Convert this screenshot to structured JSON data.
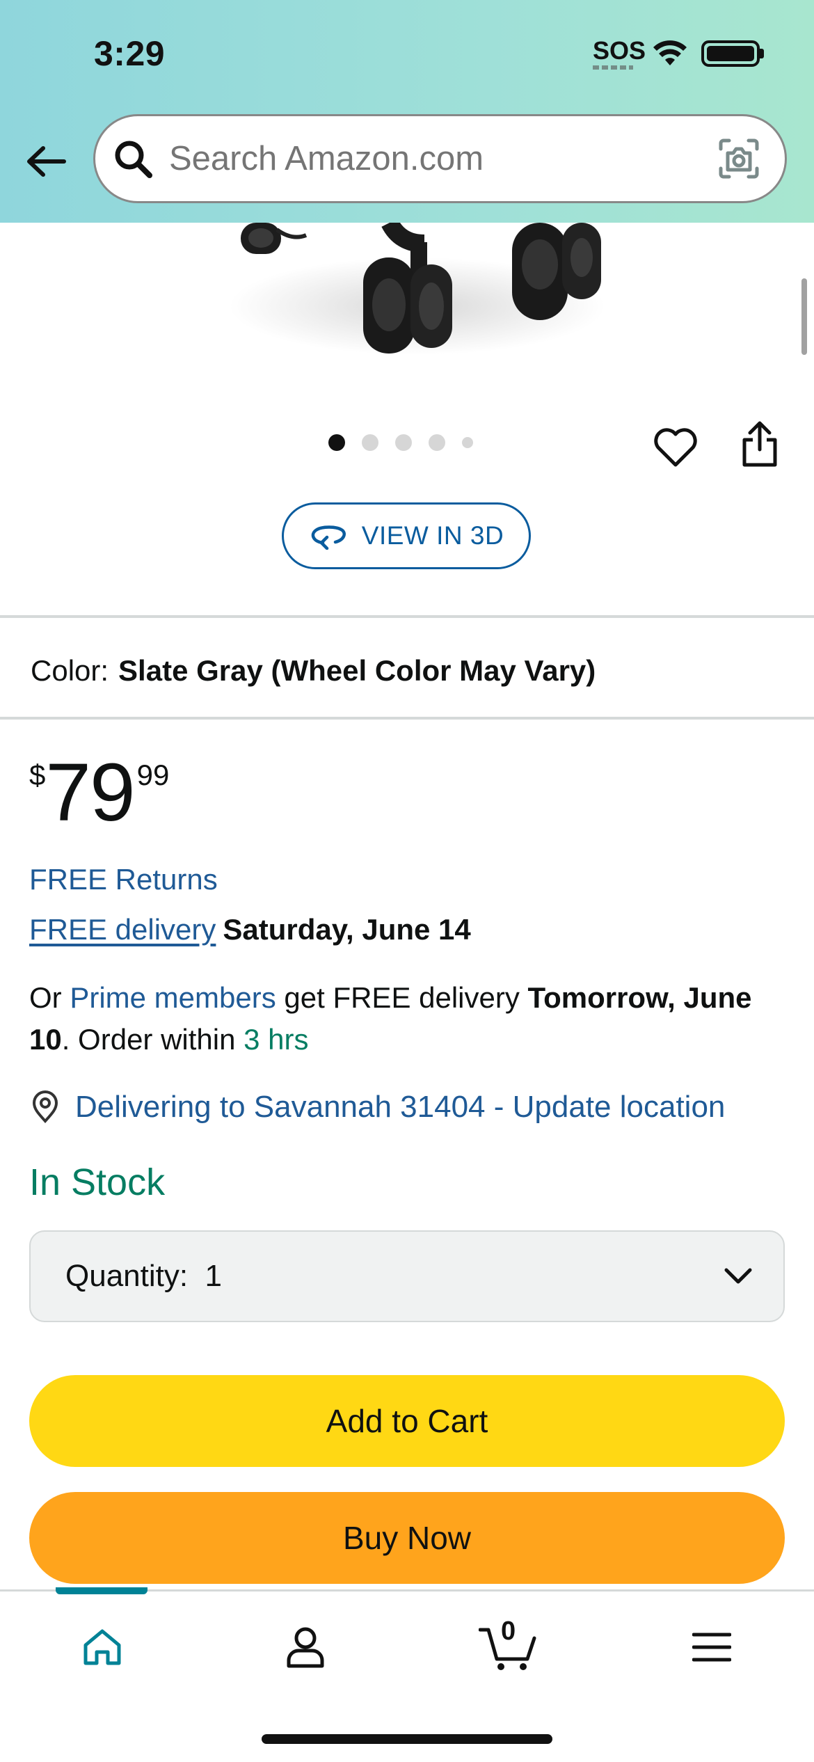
{
  "status_bar": {
    "time": "3:29",
    "sos": "SOS"
  },
  "header": {
    "search_placeholder": "Search Amazon.com"
  },
  "gallery": {
    "dot_count": 5,
    "active_dot": 1,
    "view3d_label": "VIEW IN 3D"
  },
  "color": {
    "label": "Color:",
    "value": "Slate Gray (Wheel Color May Vary)"
  },
  "price": {
    "symbol": "$",
    "whole": "79",
    "fraction": "99"
  },
  "delivery": {
    "free_returns": "FREE Returns",
    "free_delivery_link": "FREE delivery",
    "free_delivery_date": "Saturday, June 14",
    "prime": {
      "prefix": "Or ",
      "link": "Prime members",
      "middle": " get FREE delivery ",
      "bold_date": "Tomorrow, June 10",
      "order_within": ". Order within ",
      "time_left": "3 hrs"
    },
    "location": "Delivering to Savannah 31404 - Update location"
  },
  "stock": "In Stock",
  "quantity": {
    "label": "Quantity:",
    "value": "1"
  },
  "buttons": {
    "add_to_cart": "Add to Cart",
    "buy_now": "Buy Now"
  },
  "bottom_nav": {
    "items": [
      "home-icon",
      "account-icon",
      "cart-icon",
      "menu-icon"
    ],
    "cart_count": "0",
    "active": "home"
  },
  "colors": {
    "link": "#1f5a96",
    "green": "#067d62",
    "cart_button": "#ffd814",
    "buy_button": "#ffa41c",
    "nav_accent": "#008296"
  }
}
